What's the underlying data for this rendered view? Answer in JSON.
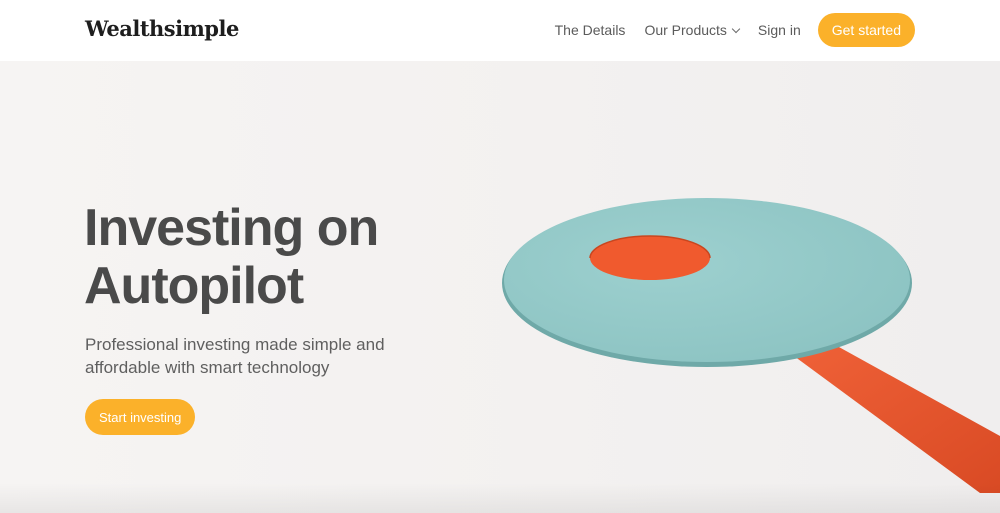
{
  "brand": {
    "name": "Wealthsimple"
  },
  "nav": {
    "details": "The Details",
    "products": "Our Products",
    "signin": "Sign in",
    "get_started": "Get started"
  },
  "hero": {
    "headline_line1": "Investing on",
    "headline_line2": "Autopilot",
    "subtitle": "Professional investing made simple and affordable with smart technology",
    "cta": "Start investing"
  },
  "colors": {
    "accent": "#fbb12a",
    "headline": "#4a4a4a",
    "teal_disc": "#93c9c8",
    "orange": "#ee5a30"
  },
  "icons": {
    "products_dropdown": "chevron-down-icon"
  }
}
